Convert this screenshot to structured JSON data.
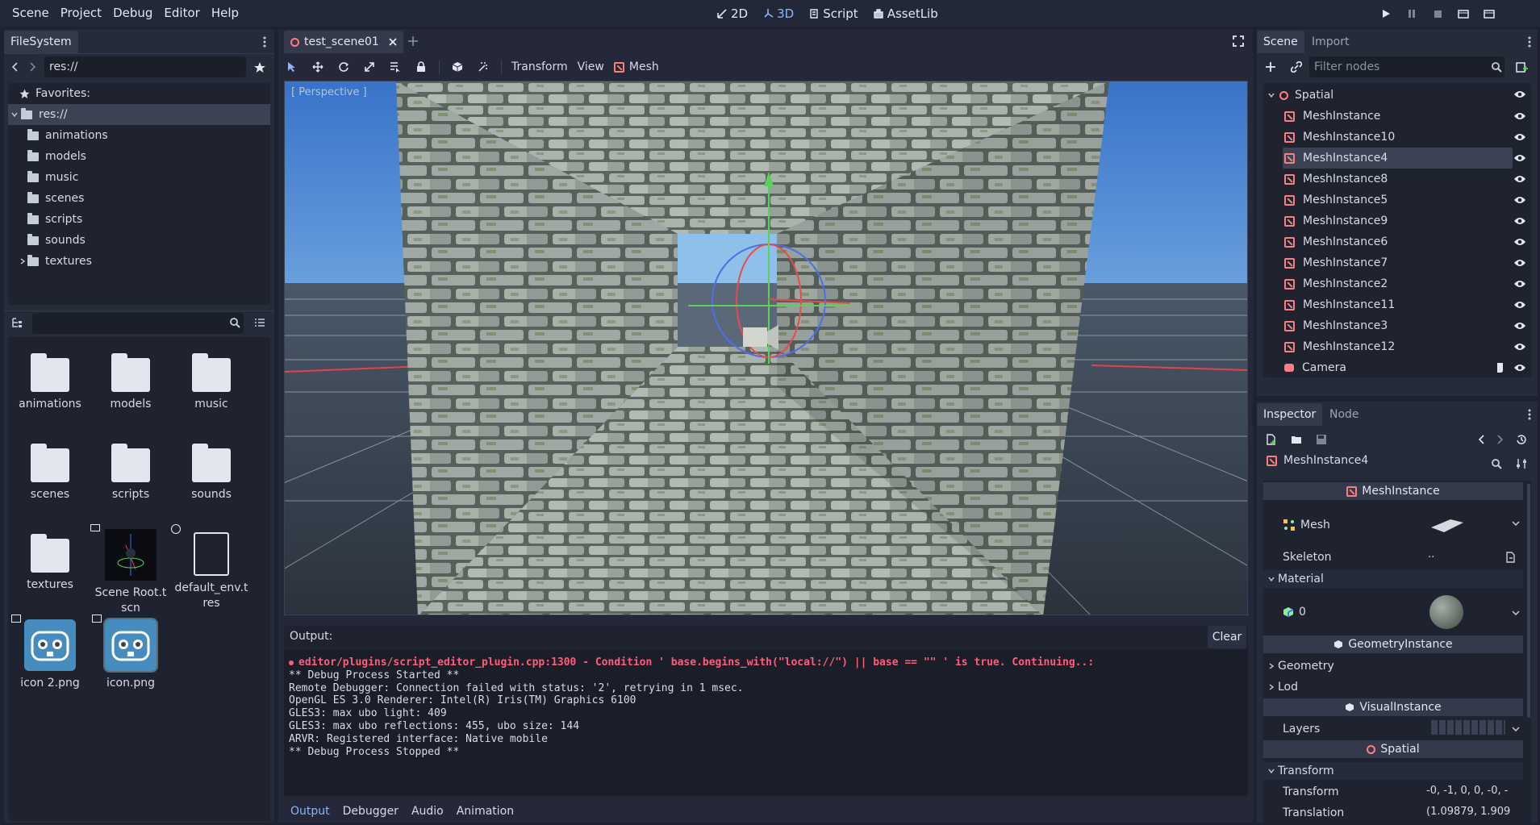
{
  "menu": {
    "scene": "Scene",
    "project": "Project",
    "debug": "Debug",
    "editor": "Editor",
    "help": "Help"
  },
  "workspaces": {
    "w2d": "2D",
    "w3d": "3D",
    "script": "Script",
    "assetlib": "AssetLib"
  },
  "filesystem": {
    "tab": "FileSystem",
    "path": "res://",
    "favorites": "Favorites:",
    "root": "res://",
    "tree": [
      "animations",
      "models",
      "music",
      "scenes",
      "scripts",
      "sounds",
      "textures"
    ],
    "grid": [
      {
        "label": "animations",
        "kind": "folder"
      },
      {
        "label": "models",
        "kind": "folder"
      },
      {
        "label": "music",
        "kind": "folder"
      },
      {
        "label": "scenes",
        "kind": "folder"
      },
      {
        "label": "scripts",
        "kind": "folder"
      },
      {
        "label": "sounds",
        "kind": "folder"
      },
      {
        "label": "textures",
        "kind": "folder"
      },
      {
        "label": "Scene Root.tscn",
        "kind": "scene"
      },
      {
        "label": "default_env.tres",
        "kind": "file"
      },
      {
        "label": "icon 2.png",
        "kind": "godot"
      },
      {
        "label": "icon.png",
        "kind": "godot"
      }
    ]
  },
  "editor": {
    "scene_tab": "test_scene01",
    "toolbar": {
      "transform": "Transform",
      "view": "View",
      "mesh": "Mesh"
    },
    "viewport_label": "[ Perspective ]"
  },
  "output": {
    "title": "Output:",
    "clear": "Clear",
    "error": "editor/plugins/script_editor_plugin.cpp:1300 - Condition ' base.begins_with(\"local://\") || base == \"\" ' is true. Continuing..:",
    "lines": [
      "** Debug Process Started **",
      "Remote Debugger: Connection failed with status: '2', retrying in 1 msec.",
      "OpenGL ES 3.0 Renderer: Intel(R) Iris(TM) Graphics 6100",
      "GLES3: max ubo light: 409",
      "GLES3: max ubo reflections: 455, ubo size: 144",
      "ARVR: Registered interface: Native mobile",
      "** Debug Process Stopped **"
    ],
    "tabs": [
      "Output",
      "Debugger",
      "Audio",
      "Animation"
    ]
  },
  "scene": {
    "tabs": [
      "Scene",
      "Import"
    ],
    "filter_placeholder": "Filter nodes",
    "root": "Spatial",
    "nodes": [
      "MeshInstance",
      "MeshInstance10",
      "MeshInstance4",
      "MeshInstance8",
      "MeshInstance5",
      "MeshInstance9",
      "MeshInstance6",
      "MeshInstance7",
      "MeshInstance2",
      "MeshInstance11",
      "MeshInstance3",
      "MeshInstance12"
    ],
    "camera": "Camera",
    "selected": "MeshInstance4"
  },
  "inspector": {
    "tabs": [
      "Inspector",
      "Node"
    ],
    "object": "MeshInstance4",
    "sec_mesh": "MeshInstance",
    "mesh": "Mesh",
    "skeleton": "Skeleton",
    "skeleton_val": "..",
    "material": "Material",
    "mat0": "0",
    "sec_geom": "GeometryInstance",
    "geometry": "Geometry",
    "lod": "Lod",
    "sec_visual": "VisualInstance",
    "layers": "Layers",
    "sec_spatial": "Spatial",
    "transform_group": "Transform",
    "transform": "Transform",
    "transform_val": "-0, -1, 0, 0, -0, -",
    "translation": "Translation",
    "translation_val": "(1.09879, 1.909"
  },
  "colors": {
    "accent": "#8db5ff",
    "mesh_icon": "#fc7f7f",
    "error": "#ff5d7a"
  }
}
